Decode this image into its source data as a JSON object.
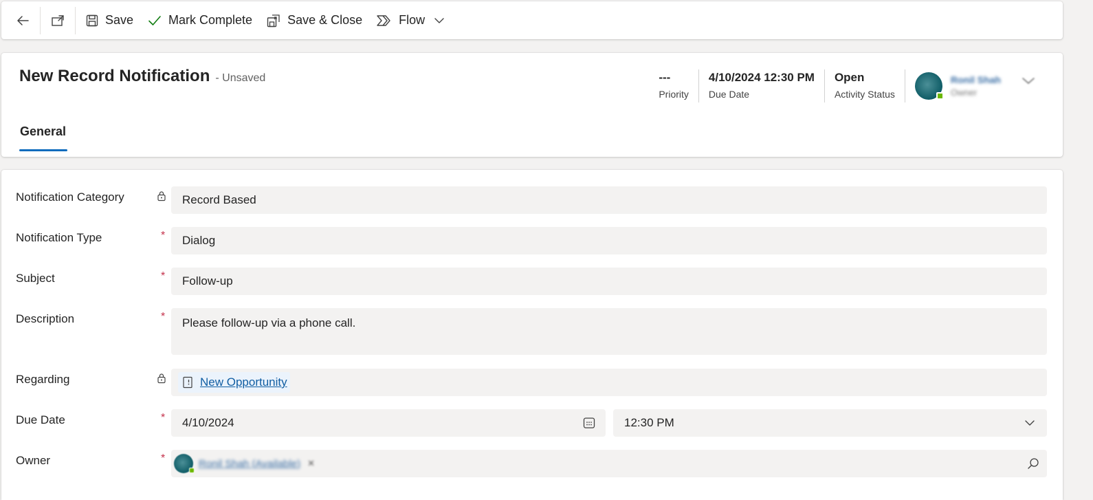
{
  "toolbar": {
    "save_label": "Save",
    "mark_complete_label": "Mark Complete",
    "save_close_label": "Save & Close",
    "flow_label": "Flow"
  },
  "header": {
    "title": "New Record Notification",
    "status_suffix": "- Unsaved",
    "fields": [
      {
        "value": "---",
        "label": "Priority"
      },
      {
        "value": "4/10/2024 12:30 PM",
        "label": "Due Date"
      },
      {
        "value": "Open",
        "label": "Activity Status"
      }
    ],
    "owner": {
      "name": "Ronil Shah",
      "label": "Owner"
    },
    "tabs": [
      {
        "label": "General"
      }
    ]
  },
  "form": {
    "notification_category": {
      "label": "Notification Category",
      "value": "Record Based"
    },
    "notification_type": {
      "label": "Notification Type",
      "value": "Dialog"
    },
    "subject": {
      "label": "Subject",
      "value": "Follow-up"
    },
    "description": {
      "label": "Description",
      "value": "Please follow-up via a phone call."
    },
    "regarding": {
      "label": "Regarding",
      "value": "New Opportunity"
    },
    "due_date": {
      "label": "Due Date",
      "date": "4/10/2024",
      "time": "12:30 PM"
    },
    "owner": {
      "label": "Owner",
      "value": "Ronil Shah (Available)"
    },
    "required_marker": "*"
  },
  "colors": {
    "accent": "#0f6cbd",
    "required": "#c4314b",
    "link": "#115ea3",
    "field_bg": "#f3f2f1",
    "check": "#107c10"
  }
}
